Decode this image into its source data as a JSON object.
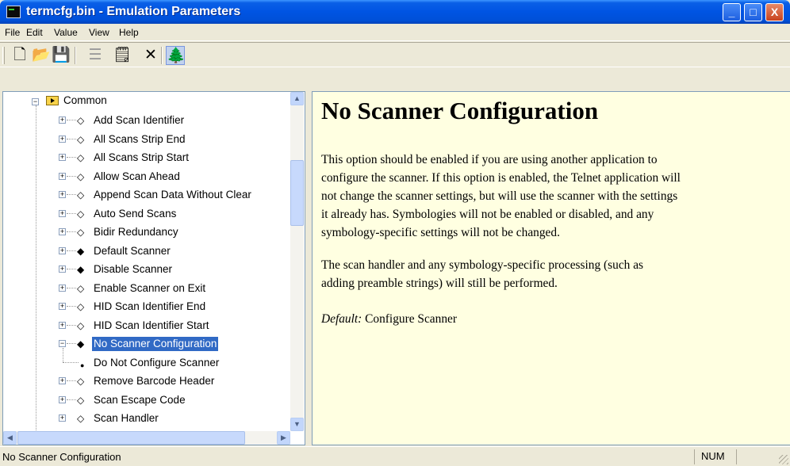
{
  "window": {
    "title": "termcfg.bin - Emulation Parameters",
    "minimize_glyph": "_",
    "maximize_glyph": "□",
    "close_glyph": "X"
  },
  "menu": {
    "file": "File",
    "edit": "Edit",
    "value": "Value",
    "view": "View",
    "help": "Help"
  },
  "toolbar": {
    "new_glyph": "🗋",
    "open_glyph": "📂",
    "save_glyph": "💾",
    "list_glyph": "☰",
    "properties_glyph": "🗒",
    "delete_glyph": "✕",
    "tree_glyph": "🌲"
  },
  "tree": {
    "root_label": "Common",
    "items": [
      {
        "label": "Add Scan Identifier",
        "filled": false
      },
      {
        "label": "All Scans Strip End",
        "filled": false
      },
      {
        "label": "All Scans Strip Start",
        "filled": false
      },
      {
        "label": "Allow Scan Ahead",
        "filled": false
      },
      {
        "label": "Append Scan Data Without Clear",
        "filled": false
      },
      {
        "label": "Auto Send Scans",
        "filled": false
      },
      {
        "label": "Bidir Redundancy",
        "filled": false
      },
      {
        "label": "Default Scanner",
        "filled": true
      },
      {
        "label": "Disable Scanner",
        "filled": true
      },
      {
        "label": "Enable Scanner on Exit",
        "filled": false
      },
      {
        "label": "HID Scan Identifier End",
        "filled": false
      },
      {
        "label": "HID Scan Identifier Start",
        "filled": false
      },
      {
        "label": "No Scanner Configuration",
        "filled": true
      },
      {
        "label": "Remove Barcode Header",
        "filled": false
      },
      {
        "label": "Scan Escape Code",
        "filled": false
      }
    ],
    "child_label": "Do Not Configure Scanner",
    "partial_label": "Scan Handler"
  },
  "detail": {
    "title": "No Scanner Configuration",
    "paragraph1_lines": [
      "This option should be enabled if you are using another application to",
      "configure the scanner.  If this option is enabled, the Telnet application will",
      "not change the scanner settings, but will use the scanner with the settings",
      "it already has.  Symbologies will not be enabled or disabled, and any",
      "symbology-specific settings will not be changed."
    ],
    "paragraph2_lines": [
      "The scan handler and any symbology-specific processing (such as",
      "adding preamble strings) will still be performed."
    ],
    "default_label": "Default:",
    "default_value": " Configure Scanner"
  },
  "status": {
    "text": "No Scanner Configuration",
    "num": "NUM"
  },
  "colors": {
    "titlebar": "#0054e3",
    "selection": "#316ac5",
    "detail_background": "#ffffe1"
  }
}
